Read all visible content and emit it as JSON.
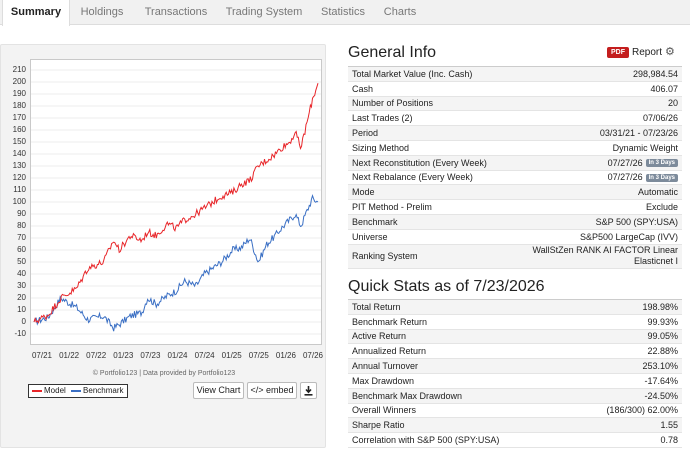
{
  "tabs": [
    {
      "label": "Summary",
      "active": true
    },
    {
      "label": "Holdings",
      "active": false
    },
    {
      "label": "Transactions",
      "active": false
    },
    {
      "label": "Trading System",
      "active": false
    },
    {
      "label": "Statistics",
      "active": false
    },
    {
      "label": "Charts",
      "active": false
    }
  ],
  "chart": {
    "credit": "© Portfolio123 | Data provided by Portfolio123",
    "view_chart_label": "View Chart",
    "embed_label": "</> embed",
    "download_icon": "download-icon"
  },
  "chart_data": {
    "type": "line",
    "ylim": [
      -15,
      215
    ],
    "yticks": [
      -10,
      0,
      10,
      20,
      30,
      40,
      50,
      60,
      70,
      80,
      90,
      100,
      110,
      120,
      130,
      140,
      150,
      160,
      170,
      180,
      190,
      200,
      210
    ],
    "xticks": [
      "07/21",
      "01/22",
      "07/22",
      "01/23",
      "07/23",
      "01/24",
      "07/24",
      "01/25",
      "07/25",
      "01/26",
      "07/26"
    ],
    "x_range": [
      "03/31/21",
      "07/23/26"
    ],
    "series": [
      {
        "name": "Model",
        "color": "#e8262a",
        "x": [
          0,
          0.05,
          0.095,
          0.15,
          0.19,
          0.245,
          0.28,
          0.3,
          0.34,
          0.38,
          0.4,
          0.43,
          0.47,
          0.5,
          0.53,
          0.57,
          0.6,
          0.63,
          0.66,
          0.7,
          0.73,
          0.76,
          0.79,
          0.82,
          0.85,
          0.87,
          0.9,
          0.92,
          0.94,
          0.96,
          0.98,
          1.0
        ],
        "y": [
          0,
          6,
          20,
          28,
          45,
          50,
          68,
          60,
          72,
          68,
          75,
          72,
          82,
          78,
          85,
          90,
          95,
          100,
          105,
          108,
          115,
          118,
          130,
          135,
          140,
          145,
          150,
          158,
          145,
          165,
          185,
          199
        ]
      },
      {
        "name": "Benchmark",
        "color": "#3a6fc4",
        "x": [
          0,
          0.05,
          0.095,
          0.15,
          0.19,
          0.245,
          0.28,
          0.3,
          0.34,
          0.38,
          0.4,
          0.43,
          0.47,
          0.5,
          0.53,
          0.57,
          0.6,
          0.63,
          0.66,
          0.7,
          0.73,
          0.76,
          0.79,
          0.82,
          0.85,
          0.87,
          0.9,
          0.92,
          0.94,
          0.96,
          0.98,
          1.0
        ],
        "y": [
          0,
          4,
          20,
          12,
          2,
          5,
          -5,
          -2,
          5,
          8,
          20,
          15,
          22,
          26,
          34,
          30,
          40,
          45,
          50,
          60,
          62,
          70,
          50,
          65,
          72,
          78,
          85,
          90,
          80,
          92,
          103,
          100
        ]
      }
    ]
  },
  "general_info": {
    "title": "General Info",
    "pdf_badge": "PDF",
    "report_label": "Report",
    "rows": [
      {
        "label": "Total Market Value (Inc. Cash)",
        "value": "298,984.54"
      },
      {
        "label": "Cash",
        "value": "406.07"
      },
      {
        "label": "Number of Positions",
        "value": "20"
      },
      {
        "label": "Last Trades",
        "label_suffix": " (2)",
        "value": "07/06/26"
      },
      {
        "label": "Period",
        "value": "03/31/21 - 07/23/26"
      },
      {
        "label": "Sizing Method",
        "value": "Dynamic Weight"
      },
      {
        "label": "Next Reconstitution (Every Week)",
        "value": "07/27/26",
        "badge": "In 3 Days"
      },
      {
        "label": "Next Rebalance (Every Week)",
        "value": "07/27/26",
        "badge": "In 3 Days"
      },
      {
        "label": "Mode",
        "value": "Automatic"
      },
      {
        "label": "PIT Method - Prelim",
        "value": "Exclude"
      },
      {
        "label": "Benchmark",
        "value": "S&P 500 (SPY:USA)"
      },
      {
        "label": "Universe",
        "value": "S&P500 LargeCap (IVV)"
      },
      {
        "label": "Ranking System",
        "value": "WallStZen RANK AI FACTOR Linear",
        "value2": "Elasticnet I"
      }
    ]
  },
  "quick_stats": {
    "title": "Quick Stats as of 7/23/2026",
    "rows": [
      {
        "label": "Total Return",
        "value": "198.98%"
      },
      {
        "label": "Benchmark Return",
        "value": "99.93%"
      },
      {
        "label": "Active Return",
        "value": "99.05%"
      },
      {
        "label": "Annualized Return",
        "value": "22.88%"
      },
      {
        "label": "Annual Turnover",
        "value": "253.10%"
      },
      {
        "label": "Max Drawdown",
        "value": "-17.64%"
      },
      {
        "label": "Benchmark Max Drawdown",
        "value": "-24.50%"
      },
      {
        "label": "Overall Winners",
        "value": "(186/300) 62.00%"
      },
      {
        "label": "Sharpe Ratio",
        "value": "1.55"
      },
      {
        "label": "Correlation with S&P 500 (SPY:USA)",
        "value": "0.78"
      }
    ]
  }
}
